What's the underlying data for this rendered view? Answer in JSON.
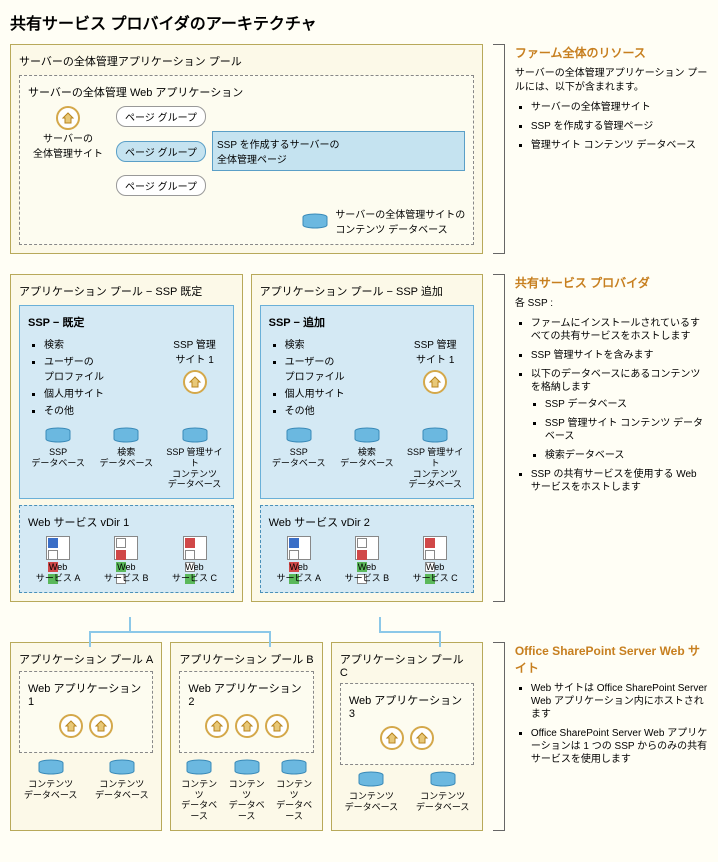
{
  "title": "共有サービス プロバイダのアーキテクチャ",
  "section1": {
    "outer_label": "サーバーの全体管理アプリケーション プール",
    "inner_label": "サーバーの全体管理 Web アプリケーション",
    "admin_site": "サーバーの\n全体管理サイト",
    "page_group": "ページ グループ",
    "ssp_create": "SSP を作成するサーバーの\n全体管理ページ",
    "content_db": "サーバーの全体管理サイトの\nコンテンツ データベース",
    "anno_title": "ファーム全体のリソース",
    "anno_text": "サーバーの全体管理アプリケーション プールには、以下が含まれます。",
    "anno_items": [
      "サーバーの全体管理サイト",
      "SSP を作成する管理ページ",
      "管理サイト コンテンツ データベース"
    ]
  },
  "section2": {
    "pool_default": "アプリケーション プール − SSP 既定",
    "pool_add": "アプリケーション プール − SSP 追加",
    "ssp_default": "SSP − 既定",
    "ssp_add": "SSP − 追加",
    "ssp_items": [
      "検索",
      "ユーザーの\nプロファイル",
      "個人用サイト",
      "その他"
    ],
    "ssp_admin": "SSP 管理\nサイト 1",
    "db1": "SSP\nデータベース",
    "db2": "検索\nデータベース",
    "db3": "SSP 管理サイト\nコンテンツ\nデータベース",
    "vdir1": "Web サービス vDir 1",
    "vdir2": "Web サービス vDir 2",
    "wsA": "Web\nサービス A",
    "wsB": "Web\nサービス B",
    "wsC": "Web\nサービス C",
    "anno_title": "共有サービス プロバイダ",
    "anno_text": "各 SSP :",
    "anno_items": [
      "ファームにインストールされているすべての共有サービスをホストします",
      "SSP 管理サイトを含みます",
      "以下のデータベースにあるコンテンツを格納します"
    ],
    "anno_sub": [
      "SSP データベース",
      "SSP 管理サイト コンテンツ データベース",
      "検索データベース"
    ],
    "anno_last": "SSP の共有サービスを使用する Web サービスをホストします"
  },
  "section3": {
    "poolA": "アプリケーション プール A",
    "poolB": "アプリケーション プール B",
    "poolC": "アプリケーション プール C",
    "app1": "Web アプリケーション 1",
    "app2": "Web アプリケーション 2",
    "app3": "Web アプリケーション 3",
    "cdb": "コンテンツ\nデータベース",
    "anno_title": "Office SharePoint Server Web サイト",
    "anno_items": [
      "Web サイトは Office SharePoint Server Web アプリケーション内にホストされます",
      "Office SharePoint Server Web アプリケーションは 1 つの SSP からのみの共有サービスを使用します"
    ]
  }
}
